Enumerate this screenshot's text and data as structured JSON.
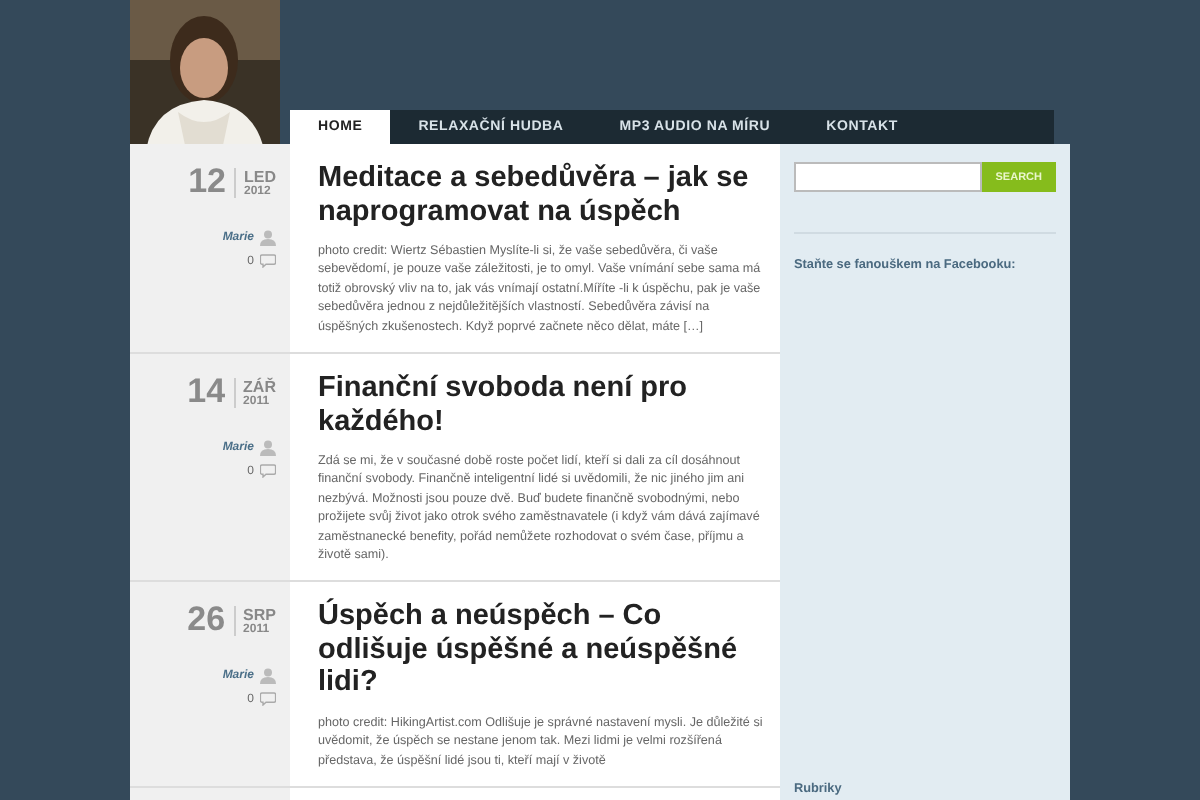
{
  "nav": [
    {
      "label": "HOME",
      "selected": true
    },
    {
      "label": "RELAXAČNÍ HUDBA",
      "selected": false
    },
    {
      "label": "MP3 AUDIO NA MÍRU",
      "selected": false
    },
    {
      "label": "KONTAKT",
      "selected": false
    }
  ],
  "posts": [
    {
      "day": "12",
      "month": "LED",
      "year": "2012",
      "author": "Marie",
      "comments": "0",
      "title": "Meditace a sebedůvěra – jak se naprogramovat na úspěch",
      "excerpt": "photo credit: Wiertz Sébastien Myslíte-li si, že vaše sebedůvěra, či vaše sebevědomí, je pouze vaše záležitosti, je to omyl. Vaše vnímání sebe sama má totiž obrovský vliv na to, jak vás vnímají ostatní.Míříte -li k úspěchu, pak je vaše sebedůvěra jednou z nejdůležitějších vlastností. Sebedůvěra závisí na úspěšných zkušenostech. Když poprvé začnete něco dělat, máte […]"
    },
    {
      "day": "14",
      "month": "ZÁŘ",
      "year": "2011",
      "author": "Marie",
      "comments": "0",
      "title": "Finanční svoboda není pro každého!",
      "excerpt": "Zdá se mi, že v současné době roste počet lidí, kteří si dali za cíl dosáhnout finanční svobody. Finančně inteligentní lidé si uvědomili, že nic jiného jim ani nezbývá. Možnosti jsou pouze dvě. Buď budete finančně svobodnými, nebo prožijete svůj život jako otrok svého zaměstnavatele (i když vám dává zajímavé zaměstnanecké benefity, pořád nemůžete rozhodovat o svém čase, příjmu a životě sami)."
    },
    {
      "day": "26",
      "month": "SRP",
      "year": "2011",
      "author": "Marie",
      "comments": "0",
      "title": "Úspěch a neúspěch – Co odlišuje úspěšné a neúspěšné lidi?",
      "excerpt": "photo credit: HikingArtist.com Odlišuje je správné nastavení mysli. Je důležité si uvědomit, že úspěch se nestane jenom tak. Mezi lidmi je velmi rozšířená představa, že úspěšní lidé jsou ti, kteří mají v životě"
    }
  ],
  "sidebar": {
    "search_button": "SEARCH",
    "facebook": "Staňte se fanouškem na Facebooku:",
    "rubriky": "Rubriky"
  }
}
